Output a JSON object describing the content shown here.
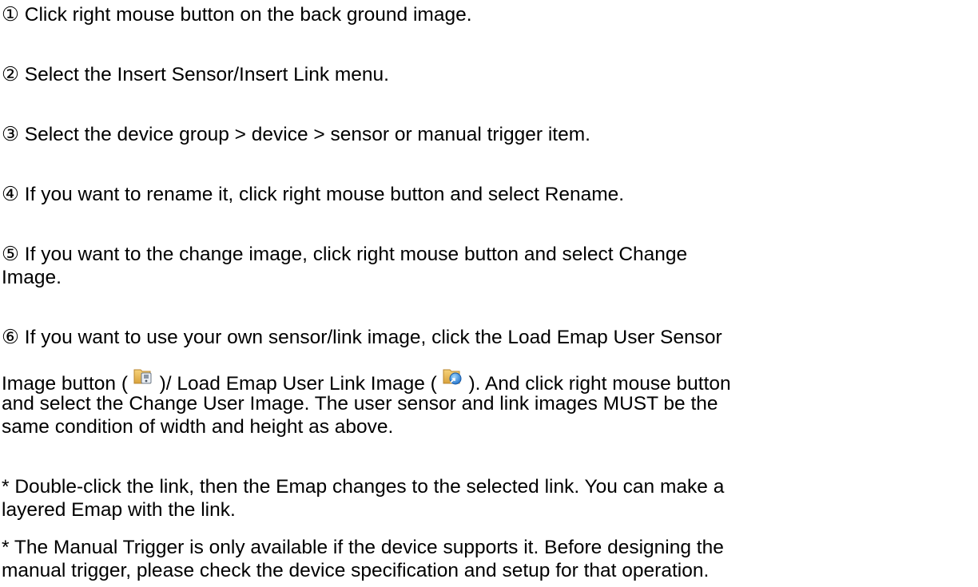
{
  "steps": {
    "s1": "① Click right mouse button on the back ground image.",
    "s2": "② Select the Insert Sensor/Insert Link menu.",
    "s3": "③ Select the device group > device > sensor or manual trigger item.",
    "s4": "④ If you want to rename it, click right mouse button and select Rename.",
    "s5_line1": "⑤ If you want to the change image, click right mouse button and select Change",
    "s5_line2": "Image.",
    "s6_line1": "⑥ If you want to use your own sensor/link image, click the Load Emap User Sensor",
    "s6_line2_a": "Image button (",
    "s6_line2_b": ")/ Load Emap User Link Image (",
    "s6_line2_c": "). And click right mouse button",
    "s6_line3": "and select the Change User Image. The user sensor and link images MUST be the",
    "s6_line4": "same condition of width and height as above."
  },
  "notes": {
    "n1_line1": "* Double-click the link, then the Emap changes to the selected link. You can make a",
    "n1_line2": "layered Emap with the link.",
    "n2_line1": "* The Manual Trigger is only available if the device supports it. Before designing the",
    "n2_line2": "manual trigger, please check the device specification and setup for that operation."
  },
  "icons": {
    "sensor_icon": "load-emap-user-sensor-image-icon",
    "link_icon": "load-emap-user-link-image-icon"
  }
}
